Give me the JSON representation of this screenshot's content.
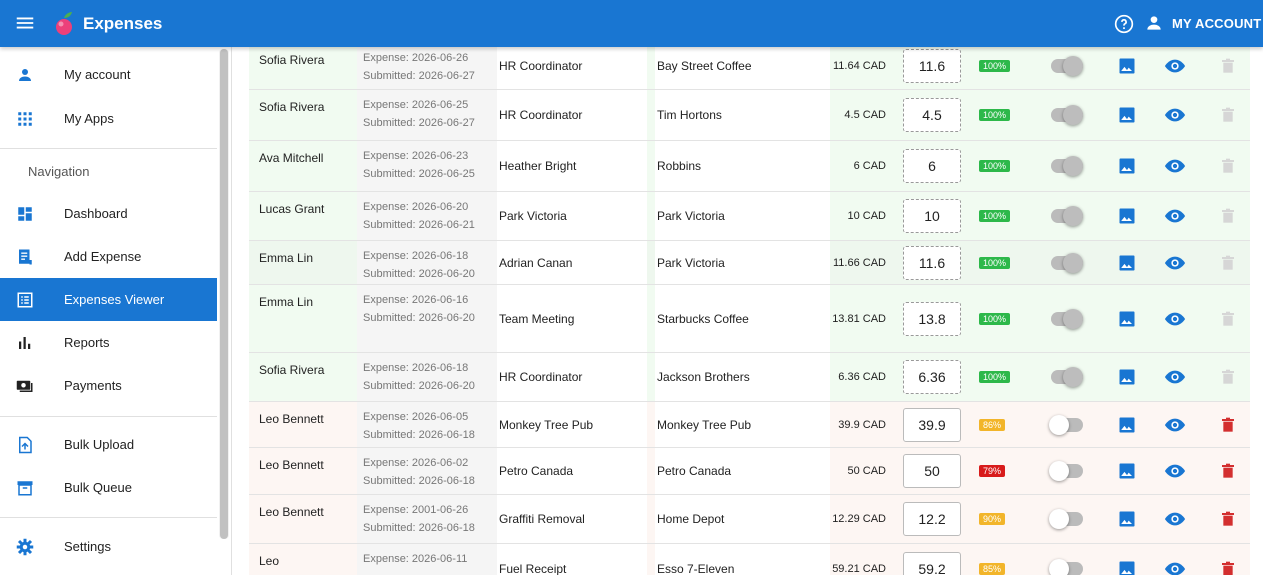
{
  "app": {
    "title": "Expenses",
    "account_label": "MY ACCOUNT"
  },
  "colors": {
    "primary": "#1976d2",
    "approved_row": "#f1fbf1",
    "flagged_row": "#fdf6f3",
    "delete_active": "#d32f2f"
  },
  "sidebar": {
    "top_items": [
      {
        "label": "My account",
        "icon": "person-icon"
      },
      {
        "label": "My Apps",
        "icon": "apps-grid-icon"
      }
    ],
    "heading": "Navigation",
    "nav_items": [
      {
        "label": "Dashboard",
        "icon": "dashboard-icon"
      },
      {
        "label": "Add Expense",
        "icon": "receipt-icon"
      },
      {
        "label": "Expenses Viewer",
        "icon": "list-icon",
        "active": true
      },
      {
        "label": "Reports",
        "icon": "bar-chart-icon"
      },
      {
        "label": "Payments",
        "icon": "payments-icon"
      }
    ],
    "bulk_items": [
      {
        "label": "Bulk Upload",
        "icon": "upload-icon"
      },
      {
        "label": "Bulk Queue",
        "icon": "archive-icon"
      }
    ],
    "settings_label": "Settings"
  },
  "rows": [
    {
      "name": "Sofia Rivera",
      "expense": "Expense: 2026-06-26",
      "submitted": "Submitted: 2026-06-27",
      "description": "HR Coordinator",
      "merchant": "Bay Street Coffee",
      "amount": "11.64 CAD",
      "input": "11.6",
      "score": "100%",
      "status": "approved"
    },
    {
      "name": "Sofia Rivera",
      "expense": "Expense: 2026-06-25",
      "submitted": "Submitted: 2026-06-27",
      "description": "HR Coordinator",
      "merchant": "Tim Hortons",
      "amount": "4.5 CAD",
      "input": "4.5",
      "score": "100%",
      "status": "approved"
    },
    {
      "name": "Ava Mitchell",
      "expense": "Expense: 2026-06-23",
      "submitted": "Submitted: 2026-06-25",
      "description": "Heather Bright",
      "merchant": "Robbins",
      "amount": "6 CAD",
      "input": "6",
      "score": "100%",
      "status": "approved"
    },
    {
      "name": "Lucas Grant",
      "expense": "Expense: 2026-06-20",
      "submitted": "Submitted: 2026-06-21",
      "description": "Park Victoria",
      "merchant": "Park Victoria",
      "amount": "10 CAD",
      "input": "10",
      "score": "100%",
      "status": "approved"
    },
    {
      "name": "Emma Lin",
      "expense": "Expense: 2026-06-18",
      "submitted": "Submitted: 2026-06-20",
      "description": "Adrian Canan",
      "merchant": "Park Victoria",
      "amount": "11.66 CAD",
      "input": "11.6",
      "score": "100%",
      "status": "approved"
    },
    {
      "name": "Emma Lin",
      "expense": "Expense: 2026-06-16",
      "submitted": "Submitted: 2026-06-20",
      "description": "Team Meeting",
      "merchant": "Starbucks Coffee",
      "amount": "13.81 CAD",
      "input": "13.8",
      "score": "100%",
      "status": "approved"
    },
    {
      "name": "Sofia Rivera",
      "expense": "Expense: 2026-06-18",
      "submitted": "Submitted: 2026-06-20",
      "description": "HR Coordinator",
      "merchant": "Jackson Brothers",
      "amount": "6.36 CAD",
      "input": "6.36",
      "score": "100%",
      "status": "approved"
    },
    {
      "name": "Leo Bennett",
      "expense": "Expense: 2026-06-05",
      "submitted": "Submitted: 2026-06-18",
      "description": "Monkey Tree Pub",
      "merchant": "Monkey Tree Pub",
      "amount": "39.9 CAD",
      "input": "39.9",
      "score": "86%",
      "status": "warning"
    },
    {
      "name": "Leo Bennett",
      "expense": "Expense: 2026-06-02",
      "submitted": "Submitted: 2026-06-18",
      "description": "Petro Canada",
      "merchant": "Petro Canada",
      "amount": "50 CAD",
      "input": "50",
      "score": "79%",
      "status": "danger"
    },
    {
      "name": "Leo Bennett",
      "expense": "Expense: 2001-06-26",
      "submitted": "Submitted: 2026-06-18",
      "description": "Graffiti Removal",
      "merchant": "Home Depot",
      "amount": "12.29 CAD",
      "input": "12.2",
      "score": "90%",
      "status": "warning"
    },
    {
      "name": "Leo",
      "expense": "Expense: 2026-06-11",
      "submitted": "",
      "description": "Fuel Receipt",
      "merchant": "Esso 7-Eleven",
      "amount": "59.21 CAD",
      "input": "59.2",
      "score": "85%",
      "status": "warning"
    }
  ]
}
